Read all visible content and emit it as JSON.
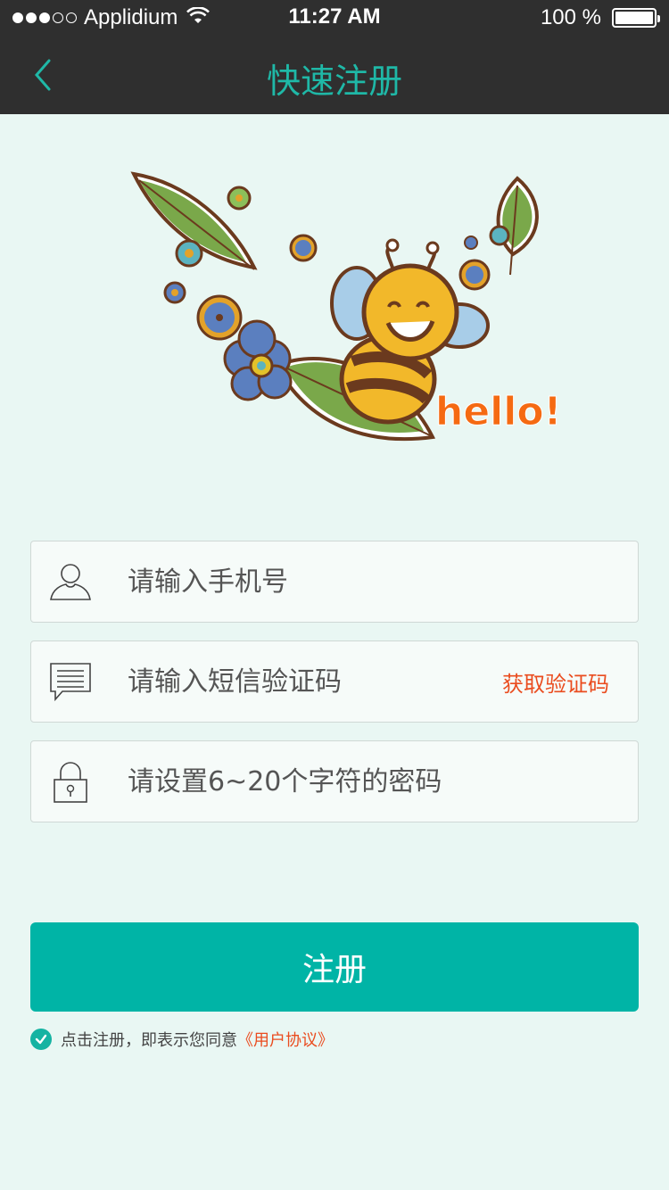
{
  "status_bar": {
    "carrier": "Applidium",
    "time": "11:27 AM",
    "battery": "100 %"
  },
  "nav": {
    "title": "快速注册",
    "back_icon": "chevron-left-icon"
  },
  "hero": {
    "text": "hello!"
  },
  "form": {
    "phone": {
      "placeholder": "请输入手机号",
      "icon": "user-icon"
    },
    "sms": {
      "placeholder": "请输入短信验证码",
      "icon": "message-icon",
      "action_label": "获取验证码"
    },
    "password": {
      "placeholder": "请设置6~20个字符的密码",
      "icon": "lock-icon"
    }
  },
  "register_button": {
    "label": "注册"
  },
  "agreement": {
    "text": "点击注册，即表示您同意",
    "link": "《用户协议》",
    "checked": true
  },
  "colors": {
    "accent": "#00b4a6",
    "header": "#2f2f2f",
    "background": "#e9f7f3",
    "warning": "#ea4c1f"
  }
}
